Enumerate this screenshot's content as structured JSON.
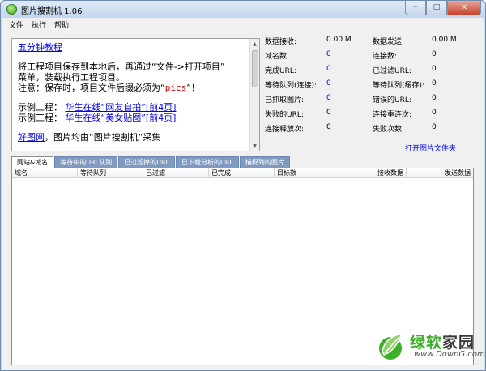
{
  "window": {
    "title": "图片搜割机 1.06"
  },
  "menu": [
    "文件",
    "执行",
    "帮助"
  ],
  "instructions": {
    "heading_link": "五分钟教程",
    "para_lines": [
      "将工程项目保存到本地后，再通过“文件->打开项目”",
      "菜单，装载执行工程项目。"
    ],
    "note_prefix": "注意：保存时，项目文件后缀必须为“",
    "note_code": "pics",
    "note_suffix": "”！",
    "examples": [
      {
        "label": "示例工程：",
        "link": "华生在线“网友自拍”[前4页]"
      },
      {
        "label": "示例工程：",
        "link": "华生在线“美女贴图”[前4页]"
      }
    ],
    "footer_link": "好图网",
    "footer_text": "，图片均由“图片搜割机”采集"
  },
  "stats_left": [
    {
      "label": "数据接收:",
      "value": "0.00 M",
      "blue": false
    },
    {
      "label": "域名数:",
      "value": "0",
      "blue": true
    },
    {
      "label": "完成URL:",
      "value": "0",
      "blue": true
    },
    {
      "label": "等待队列(连接):",
      "value": "0",
      "blue": true
    },
    {
      "label": "已抓取图片:",
      "value": "0",
      "blue": true
    },
    {
      "label": "失败的URL:",
      "value": "0",
      "blue": false
    },
    {
      "label": "连接释放次:",
      "value": "0",
      "blue": false
    }
  ],
  "stats_right": [
    {
      "label": "数据发送:",
      "value": "0.00 M",
      "blue": false
    },
    {
      "label": "连接数:",
      "value": "0",
      "blue": false
    },
    {
      "label": "已过滤URL:",
      "value": "0",
      "blue": false
    },
    {
      "label": "等待队列(缓存):",
      "value": "0",
      "blue": false
    },
    {
      "label": "错误的URL:",
      "value": "0",
      "blue": false
    },
    {
      "label": "连接重连次:",
      "value": "0",
      "blue": false
    },
    {
      "label": "失败次数:",
      "value": "0",
      "blue": false
    }
  ],
  "open_folder": "打开图片文件夹",
  "tabs": [
    "网站&域名",
    "等待中的URL队列",
    "已过滤掉的URL",
    "已下载分析的URL",
    "捕捉到的图片"
  ],
  "active_tab": 0,
  "table": {
    "columns": [
      "域名",
      "等待队列",
      "已过滤",
      "已完成",
      "目标数",
      "接收数据",
      "发送数据"
    ]
  },
  "watermark": {
    "name_green": "绿软",
    "name_dark": "家园",
    "url": "www.DownG.com"
  },
  "colors": {
    "link": "#0000ee",
    "value_blue": "#0000ee",
    "code_red": "#c00000",
    "tab_inactive": "#7f99c0",
    "logo_green": "#3fae2a"
  }
}
